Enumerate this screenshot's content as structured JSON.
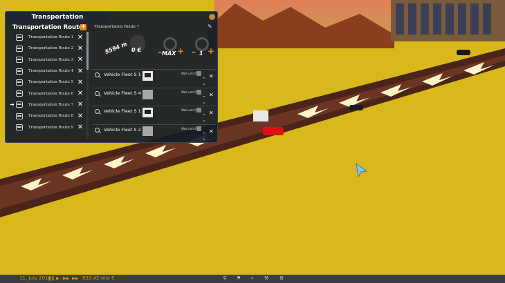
{
  "window": {
    "title": "Transportation"
  },
  "routes": {
    "header": "Transportation Routes",
    "add_label": "+",
    "items": [
      {
        "label": "Transportation Route 1"
      },
      {
        "label": "Transportation Route 2"
      },
      {
        "label": "Transportation Route 3"
      },
      {
        "label": "Transportation Route 4"
      },
      {
        "label": "Transportation Route 5"
      },
      {
        "label": "Transportation Route 6"
      },
      {
        "label": "Transportation Route 7",
        "selected": true
      },
      {
        "label": "Transportation Route 8"
      },
      {
        "label": "Transportation Route 9"
      }
    ]
  },
  "route_panel": {
    "title": "Transportation Route 7",
    "distance": "5594 m",
    "money": "0 €",
    "max_label": "MAX",
    "count": "1",
    "vehicles": [
      {
        "name": "Vehicle Fleet S 1",
        "wait_label": "Wait until full",
        "thumb": "computer"
      },
      {
        "name": "Vehicle Fleet S 4",
        "wait_label": "Wait until full",
        "thumb": "empty"
      },
      {
        "name": "Vehicle Fleet S 1",
        "wait_label": "Wait until full",
        "thumb": "computer"
      },
      {
        "name": "Vehicle Fleet S 2",
        "wait_label": "Wait until full",
        "thumb": "empty"
      }
    ]
  },
  "bottom_bar": {
    "date": "11. July 2016",
    "balance": "933.42 mio €"
  },
  "colors": {
    "accent": "#e08a1c",
    "panel": "#161e28",
    "ground": "#d4b31a"
  }
}
